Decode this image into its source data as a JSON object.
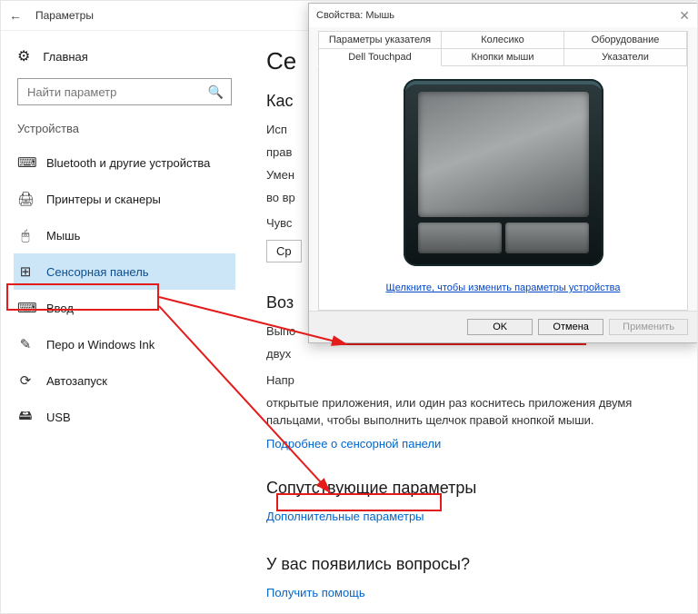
{
  "window": {
    "title": "Параметры"
  },
  "home": {
    "label": "Главная"
  },
  "search": {
    "placeholder": "Найти параметр"
  },
  "group": {
    "label": "Устройства"
  },
  "nav": {
    "items": [
      {
        "icon": "⌨",
        "label": "Bluetooth и другие устройства"
      },
      {
        "icon": "🖨",
        "label": "Принтеры и сканеры"
      },
      {
        "icon": "🖱",
        "label": "Мышь"
      },
      {
        "icon": "⊞",
        "label": "Сенсорная панель"
      },
      {
        "icon": "⌨",
        "label": "Ввод"
      },
      {
        "icon": "✎",
        "label": "Перо и Windows Ink"
      },
      {
        "icon": "⟳",
        "label": "Автозапуск"
      },
      {
        "icon": "🖴",
        "label": "USB"
      }
    ]
  },
  "content": {
    "heading": "Се",
    "section1": "Кас",
    "p1": "Исп",
    "p2": "прав",
    "p3": "Умен",
    "p4": "во вр",
    "sens_label": "Чувс",
    "sens_value": "Ср",
    "section2": "Воз",
    "p5": "Выпо",
    "p6": "двух",
    "p7": "Напр",
    "p8": "открытые приложения, или один раз коснитесь приложения двумя пальцами, чтобы выполнить щелчок правой кнопкой мыши.",
    "link1": "Подробнее о сенсорной панели",
    "section3": "Сопутствующие параметры",
    "link2": "Дополнительные параметры",
    "section4": "У вас появились вопросы?",
    "link3": "Получить помощь"
  },
  "dialog": {
    "title": "Свойства: Мышь",
    "tabs_row1": [
      "Параметры указателя",
      "Колесико",
      "Оборудование"
    ],
    "tabs_row2": [
      "Dell Touchpad",
      "Кнопки мыши",
      "Указатели"
    ],
    "link": "Щелкните, чтобы изменить параметры устройства",
    "ok": "OK",
    "cancel": "Отмена",
    "apply": "Применить"
  }
}
